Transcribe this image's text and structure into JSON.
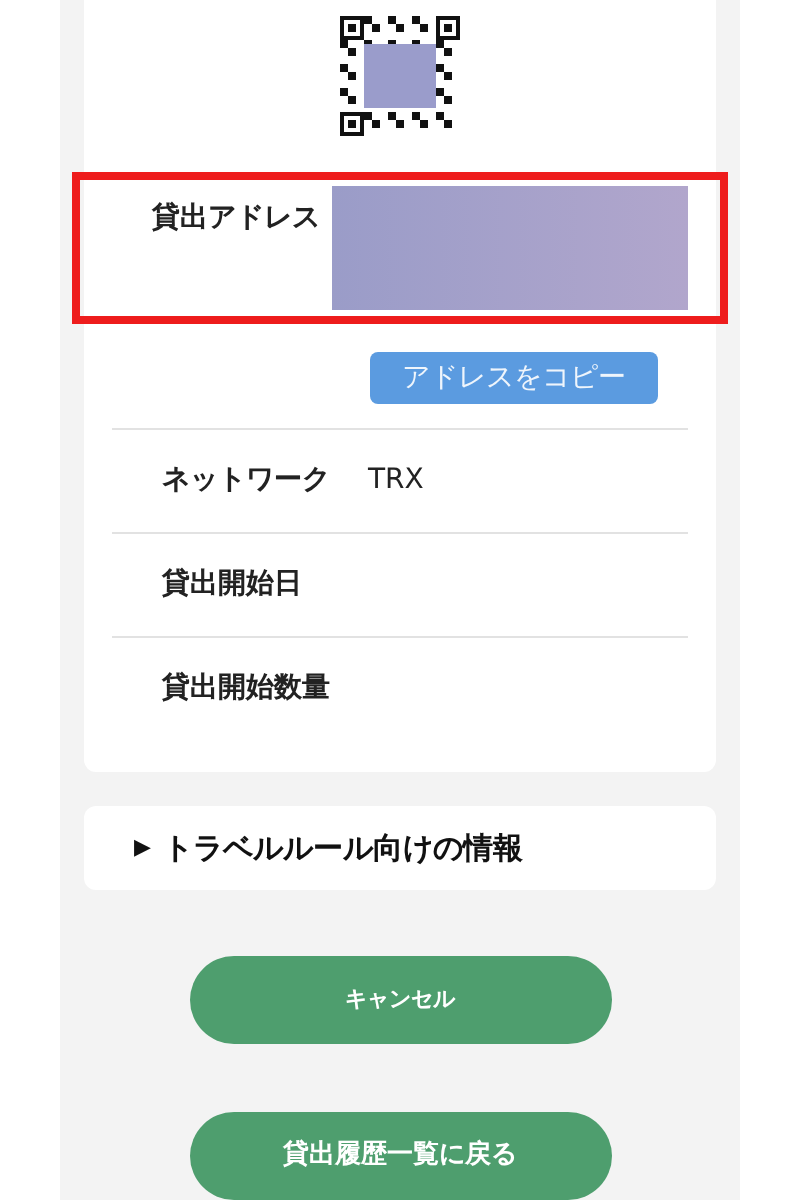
{
  "details": {
    "address_label": "貸出アドレス",
    "address_highlighted": true,
    "copy_button": "アドレスをコピー",
    "rows": [
      {
        "label": "ネットワーク",
        "value": "TRX"
      },
      {
        "label": "貸出開始日"
      },
      {
        "label": "貸出開始数量"
      }
    ]
  },
  "travel_rule": {
    "marker": "▶",
    "title": "トラベルルール向けの情報",
    "expanded": false
  },
  "buttons": [
    "キャンセル",
    "貸出履歴一覧に戻る"
  ]
}
